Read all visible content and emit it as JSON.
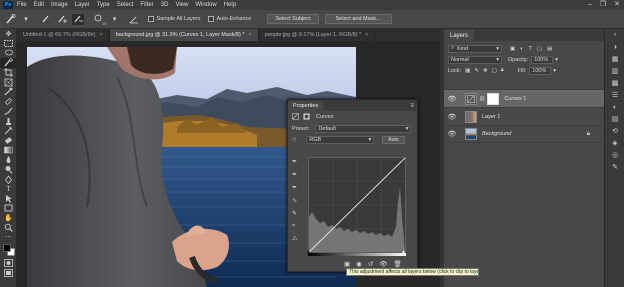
{
  "app": {
    "logo": "Ps"
  },
  "menu": [
    "File",
    "Edit",
    "Image",
    "Layer",
    "Type",
    "Select",
    "Filter",
    "3D",
    "View",
    "Window",
    "Help"
  ],
  "window_controls": [
    "–",
    "❐",
    "✕"
  ],
  "options_bar": {
    "sample_all_layers": "Sample All Layers",
    "auto_enhance": "Auto-Enhance",
    "select_subject": "Select Subject",
    "select_and_mask": "Select and Mask...",
    "brush_size": "10"
  },
  "tabs": [
    {
      "label": "Untitled-1 @ 66.7% (RGB/8#)",
      "close": "×"
    },
    {
      "label": "background.jpg @ 31.9% (Curves 1, Layer Mask/8) *",
      "close": "×"
    },
    {
      "label": "people.jpg @ 9.17% (Layer 1, RGB/8) *",
      "close": "×"
    }
  ],
  "layers_panel": {
    "tab": "Layers",
    "kind_label": "Kind",
    "blend_mode": "Normal",
    "opacity_label": "Opacity:",
    "opacity_value": "100%",
    "lock_label": "Lock:",
    "fill_label": "Fill:",
    "fill_value": "100%",
    "layers": [
      {
        "name": "Curves 1",
        "selected": true
      },
      {
        "name": "Layer 1",
        "selected": false
      },
      {
        "name": "Background",
        "selected": false,
        "locked": true
      }
    ]
  },
  "properties": {
    "tab": "Properties",
    "title": "Curves",
    "preset_label": "Preset:",
    "preset_value": "Default",
    "channel": "RGB",
    "auto": "Auto"
  },
  "tooltip": "This adjustment affects all layers below (click to clip to layer)",
  "colors": {
    "accent": "#31a8ff",
    "panel": "#484848",
    "sky": "#8aa8d8",
    "water": "#1c3e6a"
  }
}
